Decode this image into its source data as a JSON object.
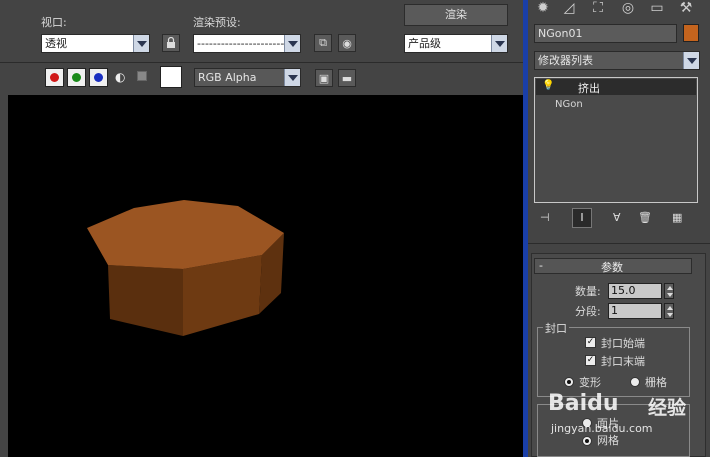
{
  "render_frame": {
    "viewport_label": "视口:",
    "viewport_value": "透视",
    "preset_label": "渲染预设:",
    "preset_value": "-------------------------",
    "render_button": "渲染",
    "quality_value": "产品级",
    "channel_value": "RGB Alpha",
    "channel_colors": {
      "red": "#d01818",
      "green": "#1a8a1a",
      "blue": "#1a2fc0"
    }
  },
  "object_color": {
    "body": "#8a4a1c",
    "top": "#9b5522"
  },
  "command_panel": {
    "object_name": "NGon01",
    "object_color_swatch": "#c4641e",
    "modifier_list_label": "修改器列表",
    "stack_items": [
      {
        "label": "挤出",
        "selected": true
      },
      {
        "label": "NGon",
        "selected": false
      }
    ],
    "params_rollout": {
      "title": "参数",
      "collapse_glyph": "-",
      "amount_label": "数量:",
      "amount_value": "15.0",
      "segments_label": "分段:",
      "segments_value": "1",
      "capping_group": "封口",
      "cap_start_label": "封口始端",
      "cap_start_checked": true,
      "cap_end_label": "封口末端",
      "cap_end_checked": true,
      "morph_label": "变形",
      "grid_label": "栅格",
      "output_partial": "面片",
      "grid2_label": "网格"
    }
  },
  "watermark": {
    "brand": "Baidu",
    "brand_cn": "经验",
    "url": "jingyan.baidu.com"
  }
}
